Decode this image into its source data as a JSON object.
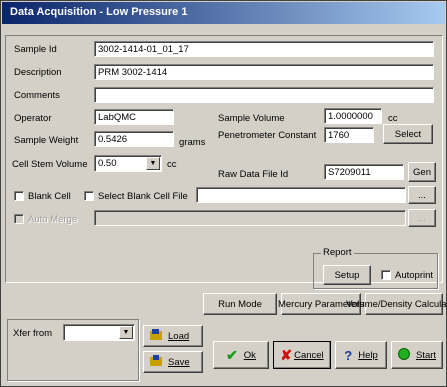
{
  "window": {
    "title": "Data Acquisition - Low Pressure 1"
  },
  "form": {
    "sample_id_label": "Sample Id",
    "sample_id": "3002-1414-01_01_17",
    "description_label": "Description",
    "description": "PRM 3002-1414",
    "comments_label": "Comments",
    "comments": "",
    "operator_label": "Operator",
    "operator": "LabQMC",
    "sample_volume_label": "Sample Volume",
    "sample_volume": "1.0000000",
    "sample_volume_unit": "cc",
    "sample_weight_label": "Sample Weight",
    "sample_weight": "0.5426",
    "sample_weight_unit": "grams",
    "penetrometer_constant_label": "Penetrometer Constant",
    "penetrometer_constant": "1760",
    "select_label": "Select",
    "cell_stem_volume_label": "Cell Stem Volume",
    "cell_stem_volume": "0.50",
    "cell_stem_volume_unit": "cc",
    "raw_data_file_id_label": "Raw Data File Id",
    "raw_data_file_id": "S7209011",
    "gen_label": "Gen",
    "blank_cell_label": "Blank Cell",
    "select_blank_cell_file_label": "Select Blank Cell File",
    "blank_cell_file": "",
    "browse_label": "...",
    "auto_merge_label": "Auto Merge",
    "auto_merge_value": "",
    "browse2_label": "..."
  },
  "report": {
    "group_label": "Report",
    "setup_label": "Setup",
    "autoprint_label": "Autoprint"
  },
  "actions": {
    "run_mode": "Run Mode",
    "mercury_parameters": "Mercury Parameters",
    "volume_density": "Volume/Density Calculation",
    "xfer_from_label": "Xfer from",
    "xfer_from_value": "",
    "load_label": "Load",
    "save_label": "Save",
    "ok_label": "Ok",
    "cancel_label": "Cancel",
    "help_label": "Help",
    "start_label": "Start"
  }
}
